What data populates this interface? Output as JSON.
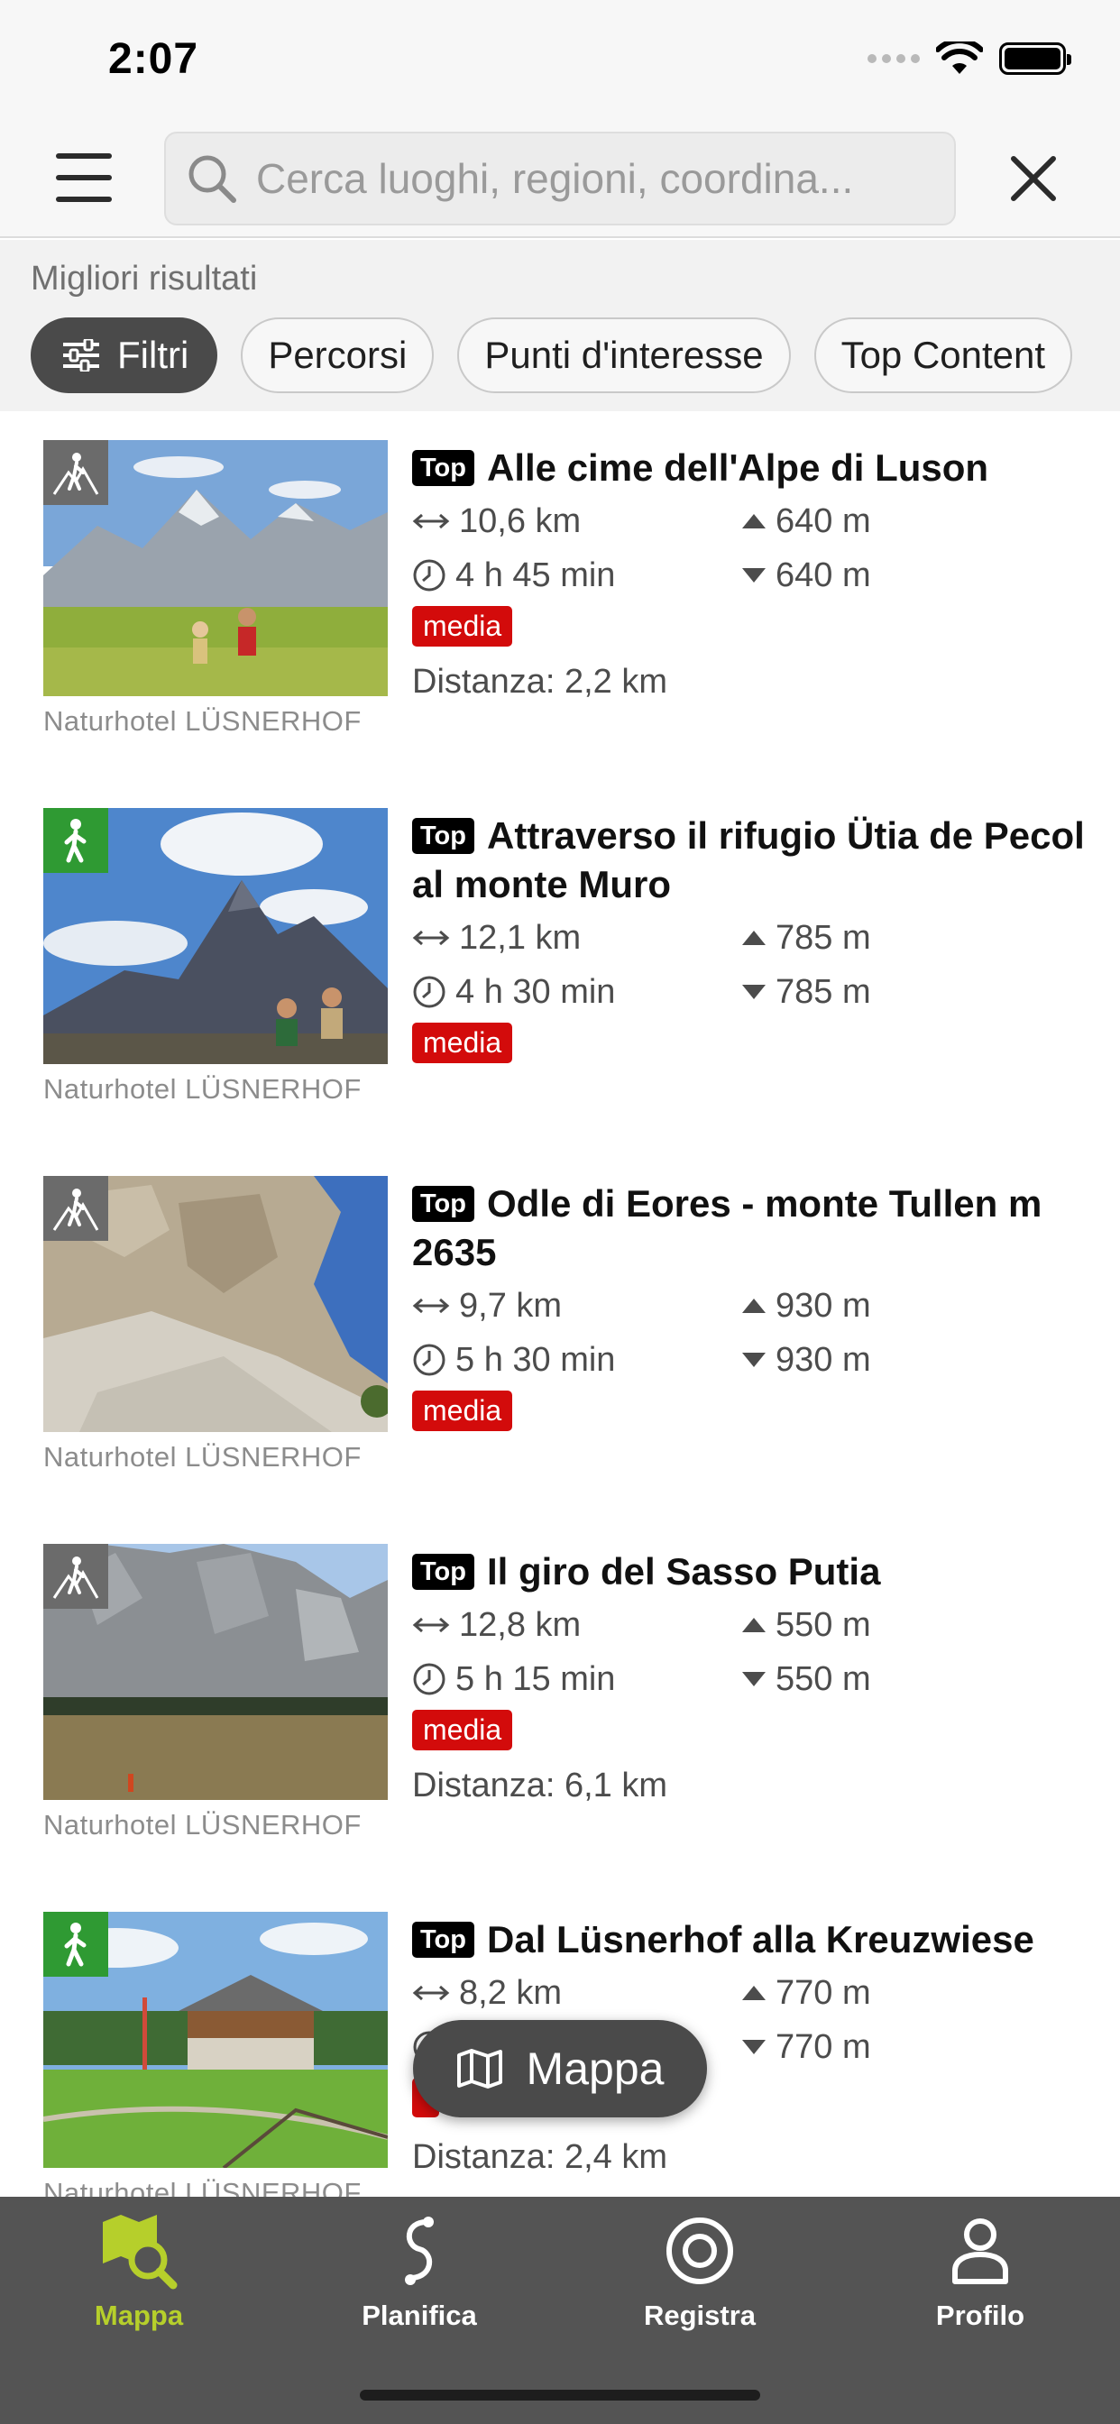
{
  "status_bar": {
    "time": "2:07"
  },
  "search": {
    "placeholder": "Cerca luoghi, regioni, coordina..."
  },
  "results": {
    "heading": "Migliori risultati"
  },
  "chips": [
    {
      "label": "Filtri",
      "icon": "sliders-icon",
      "active": true
    },
    {
      "label": "Percorsi"
    },
    {
      "label": "Punti d'interesse"
    },
    {
      "label": "Top Content"
    }
  ],
  "items": [
    {
      "badge": "Top",
      "title": "Alle cime dell'Alpe di Luson",
      "length": "10,6 km",
      "duration": "4 h 45 min",
      "ascent": "640 m",
      "descent": "640 m",
      "difficulty": "media",
      "distance": "Distanza: 2,2 km",
      "credit": "Naturhotel LÜSNERHOF",
      "category_icon": "hiking-icon"
    },
    {
      "badge": "Top",
      "title": "Attraverso il rifugio Ütia de Pecol al monte Muro",
      "length": "12,1 km",
      "duration": "4 h 30 min",
      "ascent": "785 m",
      "descent": "785 m",
      "difficulty": "media",
      "distance": "",
      "credit": "Naturhotel LÜSNERHOF",
      "category_icon": "walking-icon"
    },
    {
      "badge": "Top",
      "title": "Odle di Eores - monte Tullen m 2635",
      "length": "9,7 km",
      "duration": "5 h 30 min",
      "ascent": "930 m",
      "descent": "930 m",
      "difficulty": "media",
      "distance": "",
      "credit": "Naturhotel LÜSNERHOF",
      "category_icon": "hiking-icon"
    },
    {
      "badge": "Top",
      "title": "Il giro del Sasso Putia",
      "length": "12,8 km",
      "duration": "5 h 15 min",
      "ascent": "550 m",
      "descent": "550 m",
      "difficulty": "media",
      "distance": "Distanza: 6,1 km",
      "credit": "Naturhotel LÜSNERHOF",
      "category_icon": "hiking-icon"
    },
    {
      "badge": "Top",
      "title": "Dal Lüsnerhof alla Kreuzwiese",
      "length": "8,2 km",
      "duration": "",
      "ascent": "770 m",
      "descent": "770 m",
      "difficulty": "",
      "distance": "Distanza: 2,4 km",
      "credit": "Naturhotel LÜSNERHOF",
      "category_icon": "walking-icon"
    }
  ],
  "map_button": {
    "label": "Mappa",
    "icon": "map-icon"
  },
  "tabs": [
    {
      "label": "Mappa",
      "icon": "map-search-icon",
      "active": true
    },
    {
      "label": "Planifica",
      "icon": "route-icon"
    },
    {
      "label": "Registra",
      "icon": "record-icon"
    },
    {
      "label": "Profilo",
      "icon": "profile-icon"
    }
  ],
  "colors": {
    "accent": "#b6cf2b",
    "difficulty_red": "#d30b0b",
    "tabbar": "#545454",
    "hiking_grey": "#6b6b6b",
    "walking_green": "#2f9a33"
  }
}
